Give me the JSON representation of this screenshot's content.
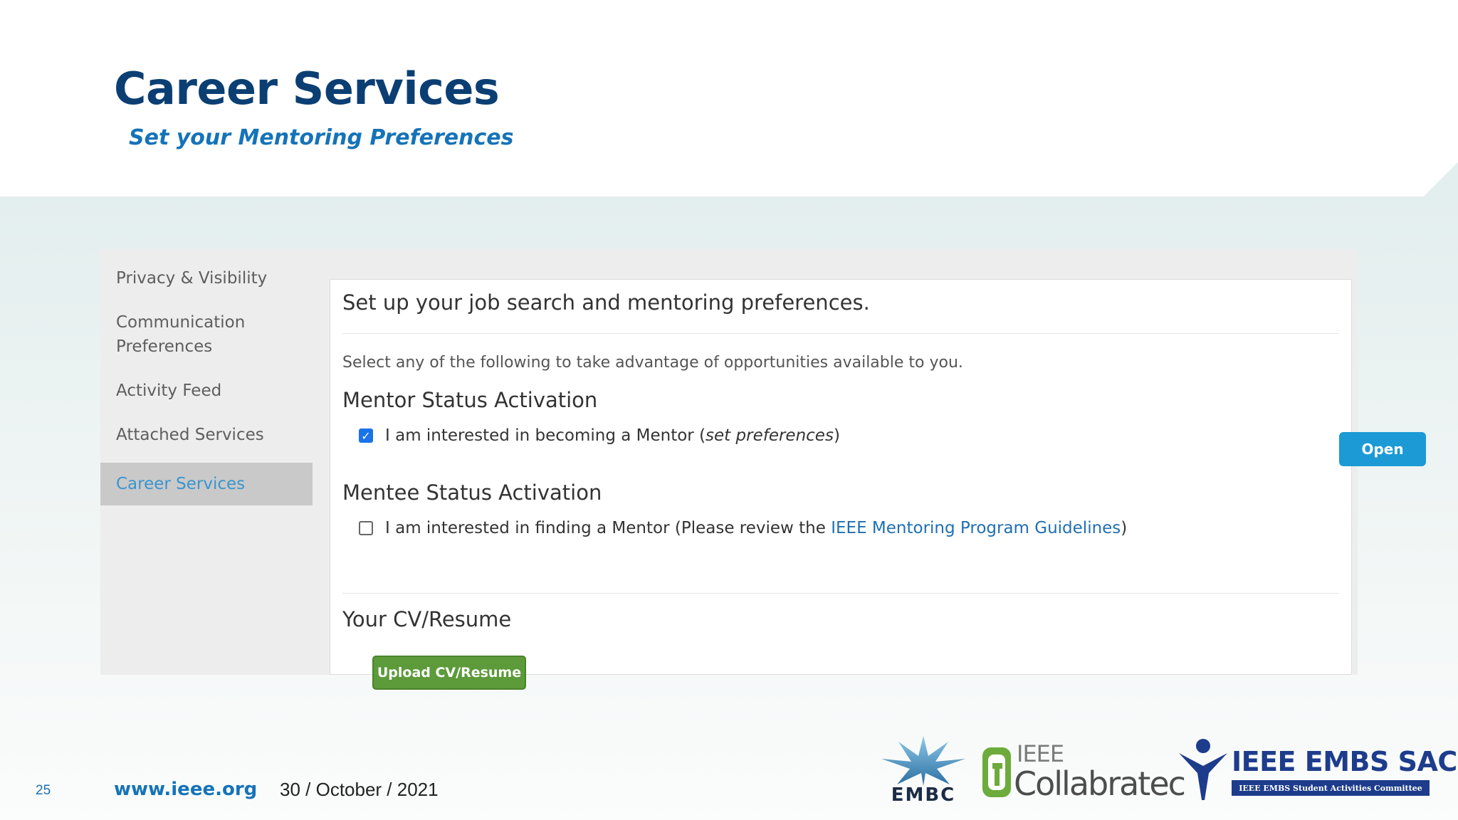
{
  "slide": {
    "title": "Career Services",
    "subtitle": "Set your Mentoring Preferences"
  },
  "sidebar": {
    "items": [
      {
        "label": "Privacy & Visibility",
        "active": false
      },
      {
        "label": "Communication",
        "label2": "Preferences",
        "active": false
      },
      {
        "label": "Activity Feed",
        "active": false
      },
      {
        "label": "Attached Services",
        "active": false
      },
      {
        "label": "Career Services",
        "active": true
      }
    ]
  },
  "content": {
    "heading": "Set up your job search and mentoring preferences.",
    "intro": "Select any of the following to take advantage of opportunities available to you.",
    "mentor": {
      "section_title": "Mentor Status Activation",
      "checkbox_checked": true,
      "text_before": "I am interested in becoming a Mentor (",
      "text_italic": "set preferences",
      "text_after": ")",
      "open_button": "Open"
    },
    "mentee": {
      "section_title": "Mentee Status Activation",
      "checkbox_checked": false,
      "text_before": "I am interested in finding a Mentor (Please review the ",
      "link_text": "IEEE Mentoring Program Guidelines",
      "text_after": ")"
    },
    "resume": {
      "section_title": "Your CV/Resume",
      "upload_button": "Upload CV/Resume"
    }
  },
  "footer": {
    "page_number": "25",
    "url": "www.ieee.org",
    "date": "30 / October / 2021"
  },
  "logos": {
    "embc": "EMBC",
    "collabratec_top": "IEEE",
    "collabratec_name": "Collabratec",
    "sac_title": "IEEE EMBS SAC",
    "sac_subtitle": "IEEE EMBS Student Activities Committee"
  },
  "colors": {
    "title": "#0b3f73",
    "subtitle": "#1573b8",
    "active_sidebar_text": "#3a95cc",
    "open_button": "#1b9ad6",
    "upload_button": "#5c9a3a",
    "link": "#1f6fb2"
  }
}
